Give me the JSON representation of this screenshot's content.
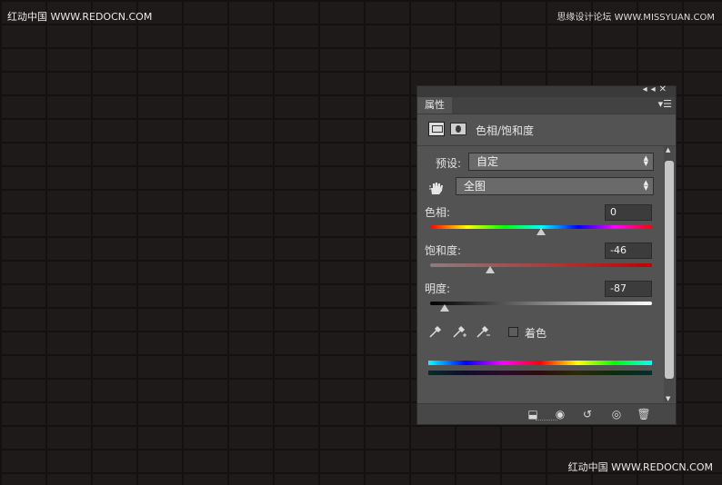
{
  "watermarks": {
    "top_left": "红动中国 WWW.REDOCN.COM",
    "top_right": "思缘设计论坛 WWW.MISSYUAN.COM",
    "bottom_right": "红动中国 WWW.REDOCN.COM"
  },
  "panel": {
    "tab_label": "属性",
    "title": "色相/饱和度",
    "preset_label": "预设:",
    "preset_value": "自定",
    "channel_value": "全图",
    "hue": {
      "label": "色相:",
      "value": "0",
      "level": 0.5
    },
    "saturation": {
      "label": "饱和度:",
      "value": "-46",
      "level": 0.27
    },
    "lightness": {
      "label": "明度:",
      "value": "-87",
      "level": 0.065
    },
    "colorize_label": "着色",
    "colorize_checked": false
  },
  "icons": [
    "collapse-icon",
    "close-icon",
    "panel-menu-icon",
    "adjustment-icon",
    "mask-icon",
    "hand-tool-icon",
    "eyedropper-icon",
    "eyedropper-plus-icon",
    "eyedropper-minus-icon",
    "clip-to-layer-icon",
    "view-previous-icon",
    "reset-icon",
    "visibility-eye-icon",
    "trash-icon"
  ],
  "colors": {
    "panel_bg": "#535353",
    "background": "#1d1a19"
  }
}
